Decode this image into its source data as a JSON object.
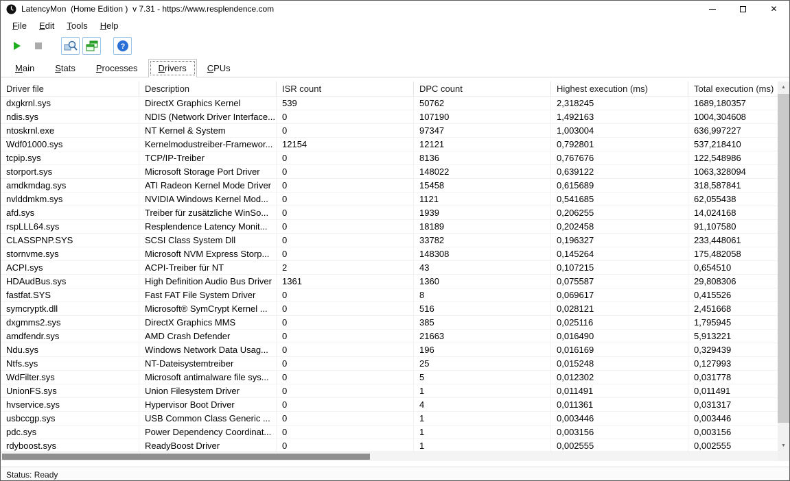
{
  "window": {
    "title": "LatencyMon  (Home Edition )  v 7.31 - https://www.resplendence.com"
  },
  "menubar": {
    "items": [
      "File",
      "Edit",
      "Tools",
      "Help"
    ]
  },
  "toolbar": {
    "icons": [
      "play-icon",
      "stop-icon",
      "analyze-magnifier-icon",
      "cascade-windows-icon",
      "help-icon"
    ],
    "colors": {
      "play": "#1fae1f",
      "stop_disabled": "#ababab",
      "cascade_green": "#2fae2f",
      "help_blue": "#2a6fd6"
    }
  },
  "tabs": {
    "items": [
      "Main",
      "Stats",
      "Processes",
      "Drivers",
      "CPUs"
    ],
    "active": "Drivers"
  },
  "table": {
    "columns": [
      "Driver file",
      "Description",
      "ISR count",
      "DPC count",
      "Highest execution (ms)",
      "Total execution (ms)"
    ],
    "rows": [
      [
        "dxgkrnl.sys",
        "DirectX Graphics Kernel",
        "539",
        "50762",
        "2,318245",
        "1689,180357"
      ],
      [
        "ndis.sys",
        "NDIS (Network Driver Interface...",
        "0",
        "107190",
        "1,492163",
        "1004,304608"
      ],
      [
        "ntoskrnl.exe",
        "NT Kernel & System",
        "0",
        "97347",
        "1,003004",
        "636,997227"
      ],
      [
        "Wdf01000.sys",
        "Kernelmodustreiber-Framewor...",
        "12154",
        "12121",
        "0,792801",
        "537,218410"
      ],
      [
        "tcpip.sys",
        "TCP/IP-Treiber",
        "0",
        "8136",
        "0,767676",
        "122,548986"
      ],
      [
        "storport.sys",
        "Microsoft Storage Port Driver",
        "0",
        "148022",
        "0,639122",
        "1063,328094"
      ],
      [
        "amdkmdag.sys",
        "ATI Radeon Kernel Mode Driver",
        "0",
        "15458",
        "0,615689",
        "318,587841"
      ],
      [
        "nvlddmkm.sys",
        "NVIDIA Windows Kernel Mod...",
        "0",
        "1121",
        "0,541685",
        "62,055438"
      ],
      [
        "afd.sys",
        "Treiber für zusätzliche WinSo...",
        "0",
        "1939",
        "0,206255",
        "14,024168"
      ],
      [
        "rspLLL64.sys",
        "Resplendence Latency Monit...",
        "0",
        "18189",
        "0,202458",
        "91,107580"
      ],
      [
        "CLASSPNP.SYS",
        "SCSI Class System Dll",
        "0",
        "33782",
        "0,196327",
        "233,448061"
      ],
      [
        "stornvme.sys",
        "Microsoft NVM Express Storp...",
        "0",
        "148308",
        "0,145264",
        "175,482058"
      ],
      [
        "ACPI.sys",
        "ACPI-Treiber für NT",
        "2",
        "43",
        "0,107215",
        "0,654510"
      ],
      [
        "HDAudBus.sys",
        "High Definition Audio Bus Driver",
        "1361",
        "1360",
        "0,075587",
        "29,808306"
      ],
      [
        "fastfat.SYS",
        "Fast FAT File System Driver",
        "0",
        "8",
        "0,069617",
        "0,415526"
      ],
      [
        "symcryptk.dll",
        "Microsoft® SymCrypt Kernel ...",
        "0",
        "516",
        "0,028121",
        "2,451668"
      ],
      [
        "dxgmms2.sys",
        "DirectX Graphics MMS",
        "0",
        "385",
        "0,025116",
        "1,795945"
      ],
      [
        "amdfendr.sys",
        "AMD Crash Defender",
        "0",
        "21663",
        "0,016490",
        "5,913221"
      ],
      [
        "Ndu.sys",
        "Windows Network Data Usag...",
        "0",
        "196",
        "0,016169",
        "0,329439"
      ],
      [
        "Ntfs.sys",
        "NT-Dateisystemtreiber",
        "0",
        "25",
        "0,015248",
        "0,127993"
      ],
      [
        "WdFilter.sys",
        "Microsoft antimalware file sys...",
        "0",
        "5",
        "0,012302",
        "0,031778"
      ],
      [
        "UnionFS.sys",
        "Union Filesystem Driver",
        "0",
        "1",
        "0,011491",
        "0,011491"
      ],
      [
        "hvservice.sys",
        "Hypervisor Boot Driver",
        "0",
        "4",
        "0,011361",
        "0,031317"
      ],
      [
        "usbccgp.sys",
        "USB Common Class Generic ...",
        "0",
        "1",
        "0,003446",
        "0,003446"
      ],
      [
        "pdc.sys",
        "Power Dependency Coordinat...",
        "0",
        "1",
        "0,003156",
        "0,003156"
      ],
      [
        "rdyboost.sys",
        "ReadyBoost Driver",
        "0",
        "1",
        "0,002555",
        "0,002555"
      ]
    ]
  },
  "statusbar": {
    "text": "Status: Ready"
  }
}
